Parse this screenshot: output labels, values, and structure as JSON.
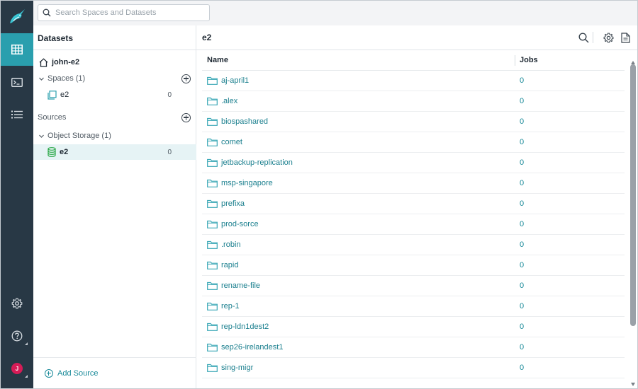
{
  "search": {
    "placeholder": "Search Spaces and Datasets"
  },
  "nav": {
    "items": [
      {
        "icon": "grid-icon",
        "active": true
      },
      {
        "icon": "terminal-icon",
        "active": false
      },
      {
        "icon": "list-icon",
        "active": false
      }
    ],
    "bottom": [
      {
        "icon": "gear-icon"
      },
      {
        "icon": "help-icon"
      },
      {
        "icon": "avatar",
        "initial": "J",
        "color": "#d61c57"
      }
    ]
  },
  "panel": {
    "title": "Datasets",
    "home": {
      "label": "john-e2"
    },
    "spaces": {
      "label": "Spaces (1)",
      "items": [
        {
          "label": "e2",
          "count": "0"
        }
      ]
    },
    "sources": {
      "label": "Sources"
    },
    "object_storage": {
      "label": "Object Storage (1)",
      "items": [
        {
          "label": "e2",
          "count": "0",
          "selected": true
        }
      ]
    },
    "add_source": "Add Source"
  },
  "main": {
    "title": "e2",
    "columns": {
      "name": "Name",
      "jobs": "Jobs"
    },
    "rows": [
      {
        "name": "aj-april1",
        "jobs": "0"
      },
      {
        "name": ".alex",
        "jobs": "0"
      },
      {
        "name": "biospashared",
        "jobs": "0"
      },
      {
        "name": "comet",
        "jobs": "0"
      },
      {
        "name": "jetbackup-replication",
        "jobs": "0"
      },
      {
        "name": "msp-singapore",
        "jobs": "0"
      },
      {
        "name": "prefixa",
        "jobs": "0"
      },
      {
        "name": "prod-sorce",
        "jobs": "0"
      },
      {
        "name": ".robin",
        "jobs": "0"
      },
      {
        "name": "rapid",
        "jobs": "0"
      },
      {
        "name": "rename-file",
        "jobs": "0"
      },
      {
        "name": "rep-1",
        "jobs": "0"
      },
      {
        "name": "rep-ldn1dest2",
        "jobs": "0"
      },
      {
        "name": "sep26-irelandest1",
        "jobs": "0"
      },
      {
        "name": "sing-migr",
        "jobs": "0"
      }
    ]
  },
  "colors": {
    "accent": "#2a9fae",
    "rail": "#283845",
    "link": "#1a7f8e"
  }
}
